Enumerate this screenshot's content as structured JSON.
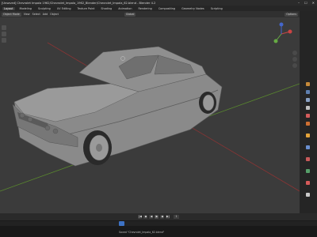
{
  "window": {
    "title": "[Unsaved] Chevrolet Impala 1962/Chevrolet_Impala_1962_Blender/Chevrolet_Impala_62.blend - Blender 4.2",
    "controls": [
      "–",
      "☐",
      "✕"
    ]
  },
  "workspace_tabs": [
    {
      "label": "Layout",
      "active": true
    },
    {
      "label": "Modeling",
      "active": false
    },
    {
      "label": "Sculpting",
      "active": false
    },
    {
      "label": "UV Editing",
      "active": false
    },
    {
      "label": "Texture Paint",
      "active": false
    },
    {
      "label": "Shading",
      "active": false
    },
    {
      "label": "Animation",
      "active": false
    },
    {
      "label": "Rendering",
      "active": false
    },
    {
      "label": "Compositing",
      "active": false
    },
    {
      "label": "Geometry Nodes",
      "active": false
    },
    {
      "label": "Scripting",
      "active": false
    }
  ],
  "viewport_header": {
    "mode": "Object Mode",
    "view": "View",
    "select": "Select",
    "add": "Add",
    "object": "Object",
    "transform": "Global",
    "options": "Options"
  },
  "timeline": {
    "current_frame": "1"
  },
  "status": {
    "file_label": "Saved \"Chevrolet_Impala_62.blend\""
  },
  "colors": {
    "viewport_bg": "#3b3b3b",
    "car_body": "#8e8e8e",
    "grid_red": "#8a3434",
    "grid_green": "#5a8a2e",
    "accent": "#3d72c4"
  }
}
